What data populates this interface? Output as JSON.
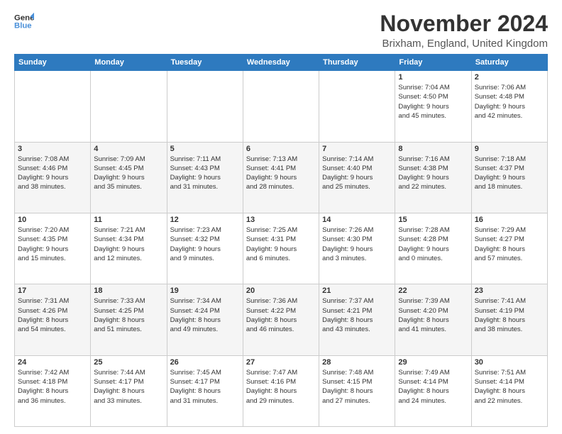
{
  "header": {
    "logo_line1": "General",
    "logo_line2": "Blue",
    "title": "November 2024",
    "subtitle": "Brixham, England, United Kingdom"
  },
  "days_of_week": [
    "Sunday",
    "Monday",
    "Tuesday",
    "Wednesday",
    "Thursday",
    "Friday",
    "Saturday"
  ],
  "weeks": [
    [
      {
        "day": "",
        "info": ""
      },
      {
        "day": "",
        "info": ""
      },
      {
        "day": "",
        "info": ""
      },
      {
        "day": "",
        "info": ""
      },
      {
        "day": "",
        "info": ""
      },
      {
        "day": "1",
        "info": "Sunrise: 7:04 AM\nSunset: 4:50 PM\nDaylight: 9 hours\nand 45 minutes."
      },
      {
        "day": "2",
        "info": "Sunrise: 7:06 AM\nSunset: 4:48 PM\nDaylight: 9 hours\nand 42 minutes."
      }
    ],
    [
      {
        "day": "3",
        "info": "Sunrise: 7:08 AM\nSunset: 4:46 PM\nDaylight: 9 hours\nand 38 minutes."
      },
      {
        "day": "4",
        "info": "Sunrise: 7:09 AM\nSunset: 4:45 PM\nDaylight: 9 hours\nand 35 minutes."
      },
      {
        "day": "5",
        "info": "Sunrise: 7:11 AM\nSunset: 4:43 PM\nDaylight: 9 hours\nand 31 minutes."
      },
      {
        "day": "6",
        "info": "Sunrise: 7:13 AM\nSunset: 4:41 PM\nDaylight: 9 hours\nand 28 minutes."
      },
      {
        "day": "7",
        "info": "Sunrise: 7:14 AM\nSunset: 4:40 PM\nDaylight: 9 hours\nand 25 minutes."
      },
      {
        "day": "8",
        "info": "Sunrise: 7:16 AM\nSunset: 4:38 PM\nDaylight: 9 hours\nand 22 minutes."
      },
      {
        "day": "9",
        "info": "Sunrise: 7:18 AM\nSunset: 4:37 PM\nDaylight: 9 hours\nand 18 minutes."
      }
    ],
    [
      {
        "day": "10",
        "info": "Sunrise: 7:20 AM\nSunset: 4:35 PM\nDaylight: 9 hours\nand 15 minutes."
      },
      {
        "day": "11",
        "info": "Sunrise: 7:21 AM\nSunset: 4:34 PM\nDaylight: 9 hours\nand 12 minutes."
      },
      {
        "day": "12",
        "info": "Sunrise: 7:23 AM\nSunset: 4:32 PM\nDaylight: 9 hours\nand 9 minutes."
      },
      {
        "day": "13",
        "info": "Sunrise: 7:25 AM\nSunset: 4:31 PM\nDaylight: 9 hours\nand 6 minutes."
      },
      {
        "day": "14",
        "info": "Sunrise: 7:26 AM\nSunset: 4:30 PM\nDaylight: 9 hours\nand 3 minutes."
      },
      {
        "day": "15",
        "info": "Sunrise: 7:28 AM\nSunset: 4:28 PM\nDaylight: 9 hours\nand 0 minutes."
      },
      {
        "day": "16",
        "info": "Sunrise: 7:29 AM\nSunset: 4:27 PM\nDaylight: 8 hours\nand 57 minutes."
      }
    ],
    [
      {
        "day": "17",
        "info": "Sunrise: 7:31 AM\nSunset: 4:26 PM\nDaylight: 8 hours\nand 54 minutes."
      },
      {
        "day": "18",
        "info": "Sunrise: 7:33 AM\nSunset: 4:25 PM\nDaylight: 8 hours\nand 51 minutes."
      },
      {
        "day": "19",
        "info": "Sunrise: 7:34 AM\nSunset: 4:24 PM\nDaylight: 8 hours\nand 49 minutes."
      },
      {
        "day": "20",
        "info": "Sunrise: 7:36 AM\nSunset: 4:22 PM\nDaylight: 8 hours\nand 46 minutes."
      },
      {
        "day": "21",
        "info": "Sunrise: 7:37 AM\nSunset: 4:21 PM\nDaylight: 8 hours\nand 43 minutes."
      },
      {
        "day": "22",
        "info": "Sunrise: 7:39 AM\nSunset: 4:20 PM\nDaylight: 8 hours\nand 41 minutes."
      },
      {
        "day": "23",
        "info": "Sunrise: 7:41 AM\nSunset: 4:19 PM\nDaylight: 8 hours\nand 38 minutes."
      }
    ],
    [
      {
        "day": "24",
        "info": "Sunrise: 7:42 AM\nSunset: 4:18 PM\nDaylight: 8 hours\nand 36 minutes."
      },
      {
        "day": "25",
        "info": "Sunrise: 7:44 AM\nSunset: 4:17 PM\nDaylight: 8 hours\nand 33 minutes."
      },
      {
        "day": "26",
        "info": "Sunrise: 7:45 AM\nSunset: 4:17 PM\nDaylight: 8 hours\nand 31 minutes."
      },
      {
        "day": "27",
        "info": "Sunrise: 7:47 AM\nSunset: 4:16 PM\nDaylight: 8 hours\nand 29 minutes."
      },
      {
        "day": "28",
        "info": "Sunrise: 7:48 AM\nSunset: 4:15 PM\nDaylight: 8 hours\nand 27 minutes."
      },
      {
        "day": "29",
        "info": "Sunrise: 7:49 AM\nSunset: 4:14 PM\nDaylight: 8 hours\nand 24 minutes."
      },
      {
        "day": "30",
        "info": "Sunrise: 7:51 AM\nSunset: 4:14 PM\nDaylight: 8 hours\nand 22 minutes."
      }
    ]
  ]
}
